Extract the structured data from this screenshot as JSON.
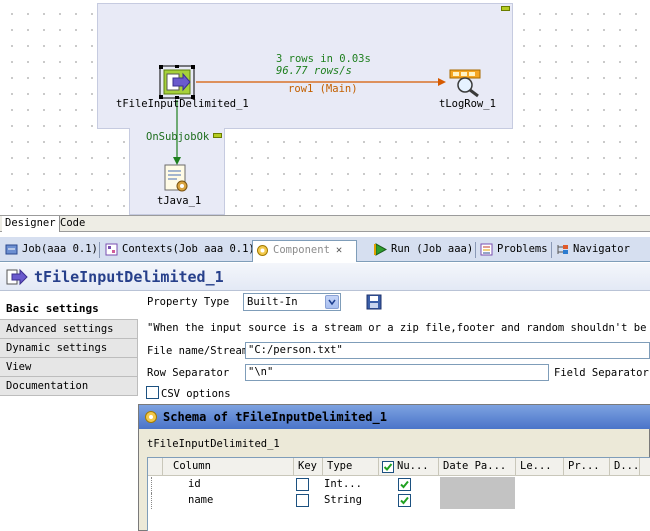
{
  "designer": {
    "nodes": {
      "input": {
        "label": "tFileInputDelimited_1",
        "icon": "file-input-arrow-icon"
      },
      "log": {
        "label": "tLogRow_1",
        "icon": "log-magnifier-icon"
      },
      "java": {
        "label": "tJava_1",
        "icon": "java-script-icon"
      }
    },
    "flow": {
      "stats_rows": "3 rows in 0.03s",
      "stats_rate": "96.77 rows/s",
      "row_label": "row1 (Main)",
      "trigger_label": "OnSubjobOk"
    },
    "colors": {
      "subjob_bg": "#e8eaf6",
      "row_link": "#d65a00",
      "trigger_link": "#1e7f1e",
      "stats_text": "#1e7f1e"
    }
  },
  "editor_tabs": [
    {
      "label": "Designer",
      "active": true
    },
    {
      "label": "Code",
      "active": false
    }
  ],
  "view_tabs": [
    {
      "label": "Job(aaa 0.1)",
      "icon": "job-icon"
    },
    {
      "label": "Contexts(Job aaa 0.1)",
      "icon": "contexts-icon"
    },
    {
      "label": "Component",
      "icon": "component-icon",
      "active": true,
      "close": "✕"
    },
    {
      "label": "Run (Job aaa)",
      "icon": "run-icon"
    },
    {
      "label": "Problems",
      "icon": "problems-icon"
    },
    {
      "label": "Navigator",
      "icon": "navigator-icon"
    }
  ],
  "component": {
    "title": "tFileInputDelimited_1"
  },
  "settings_tabs": [
    {
      "label": "Basic settings",
      "active": true
    },
    {
      "label": "Advanced settings"
    },
    {
      "label": "Dynamic settings"
    },
    {
      "label": "View"
    },
    {
      "label": "Documentation"
    }
  ],
  "basic": {
    "property_type_label": "Property Type",
    "property_type_value": "Built-In",
    "info_text": "\"When the input source is a stream or a zip file,footer and random shouldn't be bigg",
    "file_label": "File name/Stream",
    "file_value": "\"C:/person.txt\"",
    "row_sep_label": "Row Separator",
    "row_sep_value": "\"\\n\"",
    "field_sep_label": "Field Separator",
    "csv_label": "CSV options"
  },
  "schema": {
    "title": "Schema of tFileInputDelimited_1",
    "subtitle": "tFileInputDelimited_1",
    "columns": [
      "Column",
      "Key",
      "Type",
      "Nu...",
      "Date Pa...",
      "Le...",
      "Pr...",
      "D..."
    ],
    "rows": [
      {
        "column": "id",
        "key": false,
        "type": "Int...",
        "nullable": true
      },
      {
        "column": "name",
        "key": false,
        "type": "String",
        "nullable": true
      }
    ]
  }
}
